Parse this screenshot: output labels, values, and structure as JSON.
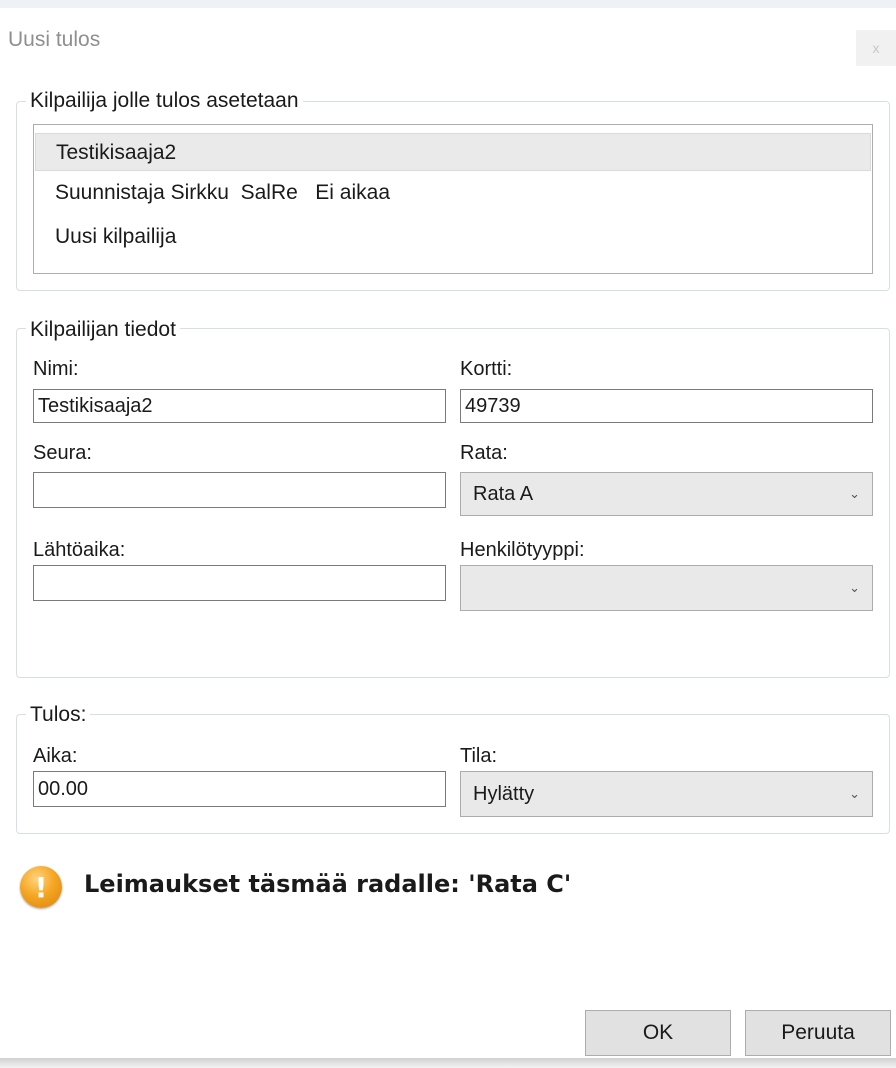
{
  "window": {
    "title": "Uusi tulos",
    "close_label": "x"
  },
  "competitor_group": {
    "legend": "Kilpailija jolle tulos asetetaan",
    "items": [
      {
        "label": "Testikisaaja2",
        "selected": true
      },
      {
        "label": "Suunnistaja Sirkku  SalRe   Ei aikaa",
        "selected": false
      },
      {
        "label": "Uusi kilpailija",
        "selected": false
      }
    ]
  },
  "details_group": {
    "legend": "Kilpailijan tiedot",
    "name_label": "Nimi:",
    "name_value": "Testikisaaja2",
    "card_label": "Kortti:",
    "card_value": "49739",
    "club_label": "Seura:",
    "club_value": "",
    "course_label": "Rata:",
    "course_value": "Rata A",
    "start_label": "Lähtöaika:",
    "start_value": "",
    "person_type_label": "Henkilötyyppi:",
    "person_type_value": ""
  },
  "result_group": {
    "legend": "Tulos:",
    "time_label": "Aika:",
    "time_value": "00.00",
    "status_label": "Tila:",
    "status_value": "Hylätty"
  },
  "warning": {
    "icon": "warning-icon",
    "text": "Leimaukset täsmää radalle: 'Rata C'",
    "color": "#f5a623"
  },
  "buttons": {
    "ok": "OK",
    "cancel": "Peruuta"
  }
}
